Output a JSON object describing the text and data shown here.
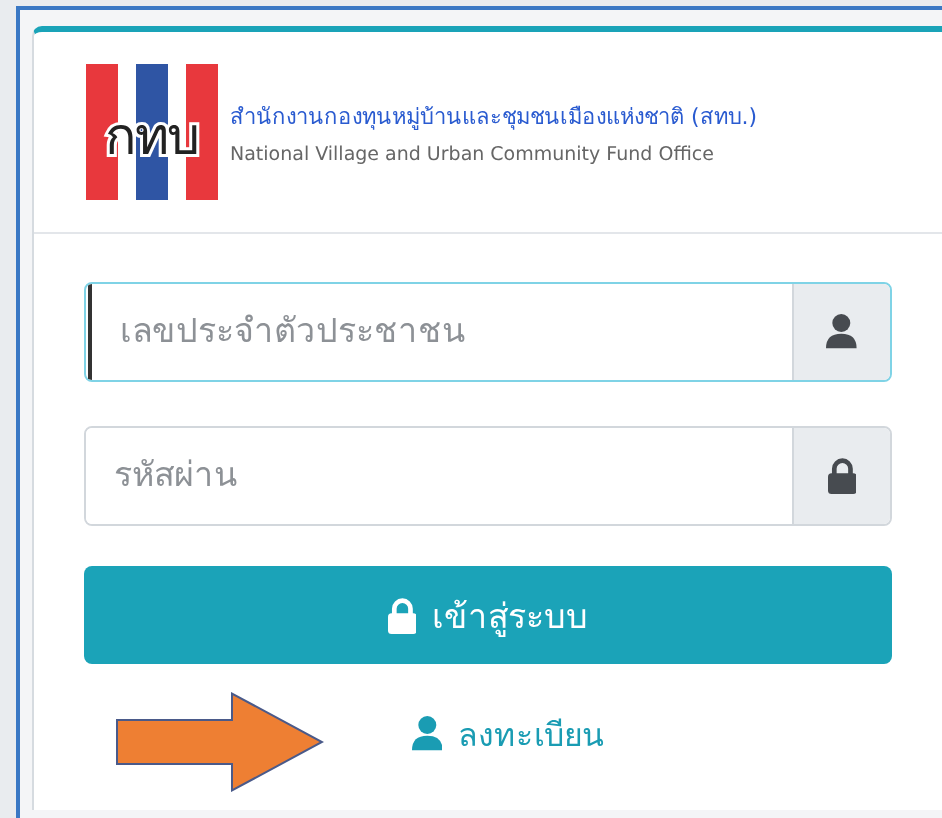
{
  "logo": {
    "mark": "กทบ",
    "title": "สำนักงานกองทุนหมู่บ้านและชุมชนเมืองแห่งชาติ (สทบ.)",
    "subtitle": "National Village and Urban Community Fund Office"
  },
  "fields": [
    {
      "kind": "user",
      "placeholder": "เลขประจำตัวประชาชน",
      "focused": true
    },
    {
      "kind": "lock",
      "placeholder": "รหัสผ่าน",
      "focused": false
    }
  ],
  "login_button": {
    "label": "เข้าสู่ระบบ"
  },
  "register_link": {
    "label": "ลงทะเบียน"
  }
}
